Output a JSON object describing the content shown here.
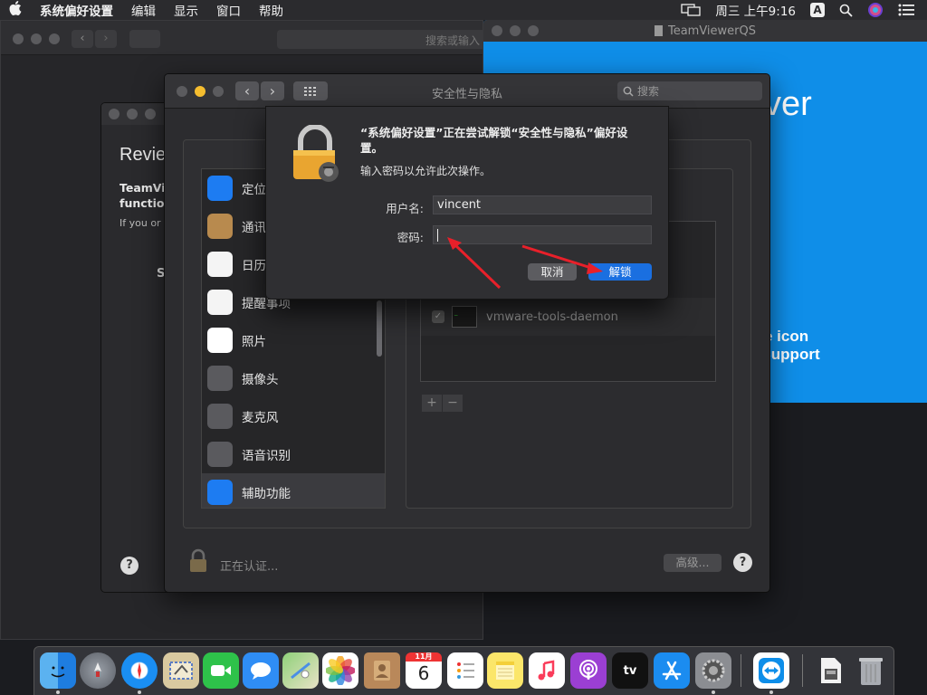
{
  "menubar": {
    "apple_icon": "apple-icon",
    "items": [
      "系统偏好设置",
      "编辑",
      "显示",
      "窗口",
      "帮助"
    ],
    "clock": "周三 上午9:16",
    "input_badge": "A"
  },
  "bg_window": {
    "search_placeholder": "搜索或输入"
  },
  "teamviewer": {
    "title": "TeamViewerQS",
    "logo_partial": "ver",
    "text_line1": "e icon",
    "text_line2": "kSupport"
  },
  "mid_window": {
    "heading": "Revie",
    "bold1": "TeamVi",
    "bold2": "function",
    "small": "If you or",
    "s_letter": "S"
  },
  "security_window": {
    "title": "安全性与隐私",
    "search_placeholder": "搜索",
    "sidebar": [
      {
        "label": "定位",
        "icon": "location-icon",
        "color": "#1d7cf2"
      },
      {
        "label": "通讯",
        "icon": "contacts-icon",
        "color": "#b88a4e"
      },
      {
        "label": "日历",
        "icon": "calendar-icon",
        "color": "#f4f4f4"
      },
      {
        "label": "提醒事项",
        "icon": "reminders-icon",
        "color": "#f4f4f4"
      },
      {
        "label": "照片",
        "icon": "photos-icon",
        "color": "#ffffff"
      },
      {
        "label": "摄像头",
        "icon": "camera-icon",
        "color": "#5a5a5e"
      },
      {
        "label": "麦克风",
        "icon": "microphone-icon",
        "color": "#5a5a5e"
      },
      {
        "label": "语音识别",
        "icon": "speech-icon",
        "color": "#5a5a5e"
      },
      {
        "label": "辅助功能",
        "icon": "accessibility-icon",
        "color": "#1d7cf2"
      }
    ],
    "app_list": [
      {
        "name": "vmware-tools-daemon",
        "checked": true
      }
    ],
    "add_label": "+",
    "remove_label": "−",
    "status": "正在认证...",
    "advanced_label": "高级...",
    "help_label": "?"
  },
  "dialog": {
    "message": "“系统偏好设置”正在尝试解锁“安全性与隐私”偏好设置。",
    "sub_message": "输入密码以允许此次操作。",
    "username_label": "用户名:",
    "username_value": "vincent",
    "password_label": "密码:",
    "password_value": "",
    "cancel_label": "取消",
    "unlock_label": "解锁",
    "accent": "#1a6fe0"
  },
  "dock": {
    "calendar_month": "11月",
    "calendar_day": "6",
    "tv_label": "tv"
  }
}
